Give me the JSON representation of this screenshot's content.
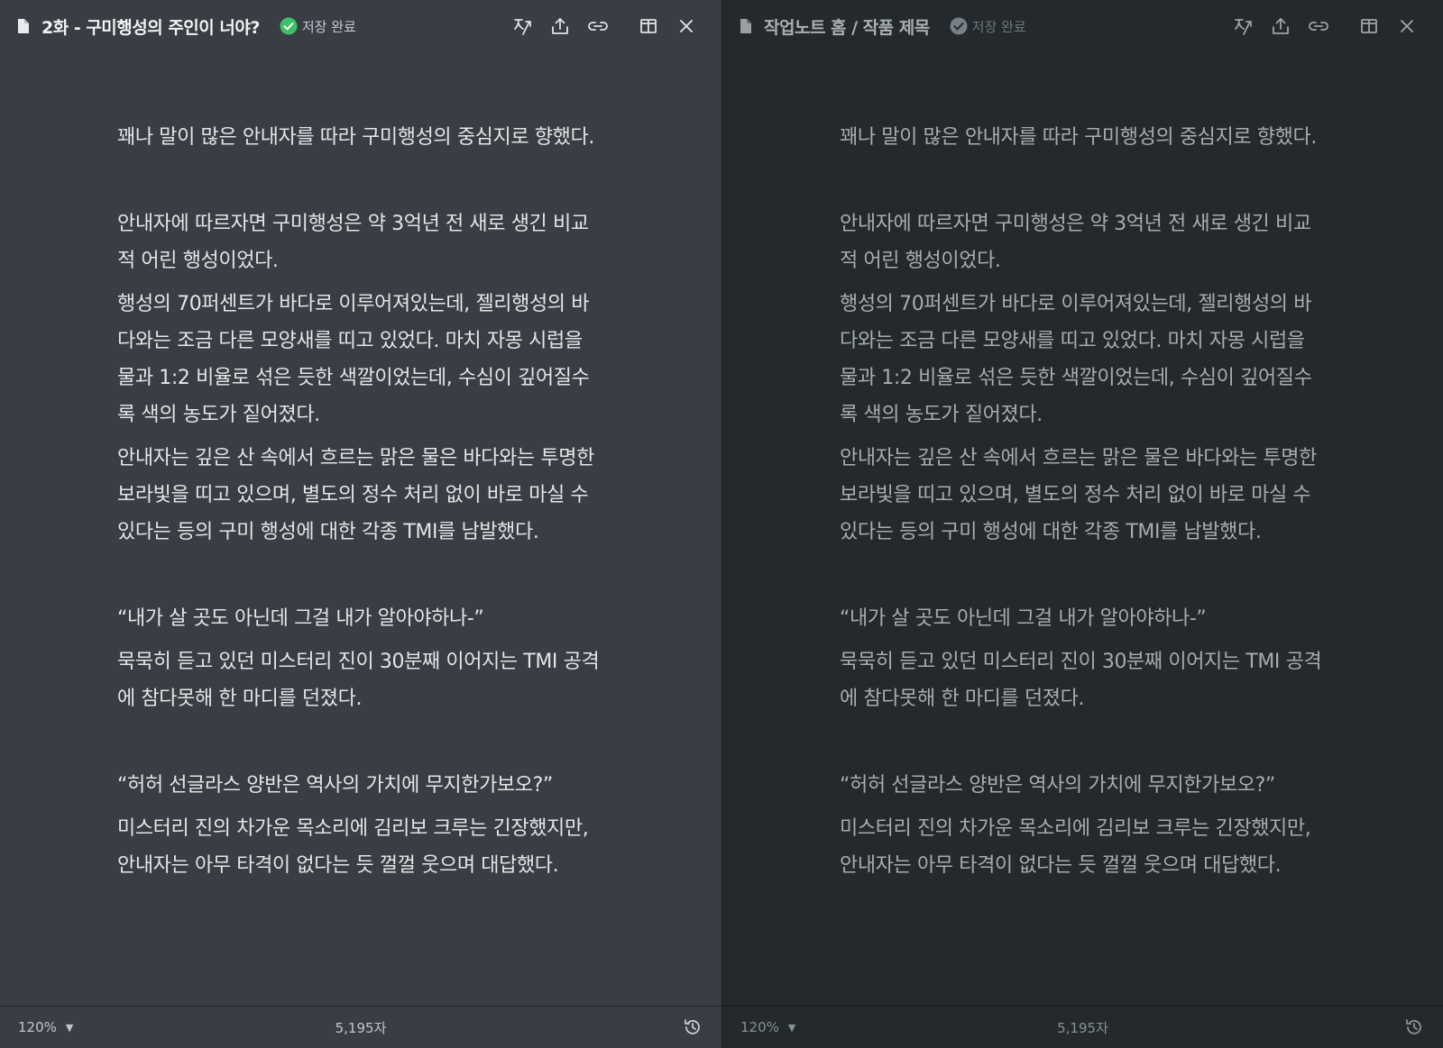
{
  "colors": {
    "left_bg": "#383e43",
    "right_bg": "#23292c",
    "saved_green": "#3fbf6a",
    "saved_gray": "#7a8186"
  },
  "panes": [
    {
      "title": "2화 - 구미행성의 주인이 너야?",
      "status": "저장 완료",
      "status_icon": "check-circle-icon",
      "paragraphs": [
        "꽤나 말이 많은 안내자를 따라 구미행성의 중심지로 향했다.",
        "안내자에 따르자면 구미행성은 약 3억년 전 새로 생긴 비교적 어린 행성이었다.",
        "행성의 70퍼센트가 바다로 이루어져있는데, 젤리행성의 바다와는 조금 다른 모양새를 띠고 있었다. 마치 자몽 시럽을 물과 1:2 비율로 섞은 듯한 색깔이었는데, 수심이 깊어질수록 색의 농도가 짙어졌다.",
        "안내자는 깊은 산 속에서 흐르는 맑은 물은 바다와는 투명한 보라빛을 띠고 있으며, 별도의 정수 처리 없이 바로 마실 수 있다는 등의 구미 행성에 대한 각종 TMI를 남발했다.",
        "“내가 살 곳도 아닌데 그걸 내가 알아야하나-”",
        "묵묵히 듣고 있던 미스터리 진이 30분째 이어지는 TMI 공격에 참다못해 한 마디를 던졌다.",
        "“허허 선글라스 양반은 역사의 가치에 무지한가보오?”",
        "미스터리 진의 차가운 목소리에 김리보 크루는 긴장했지만, 안내자는 아무 타격이 없다는 듯 껄껄 웃으며 대답했다."
      ],
      "zoom": "120%",
      "word_count": "5,195자"
    },
    {
      "title": "작업노트 홈 / 작품 제목",
      "status": "저장 완료",
      "status_icon": "check-circle-icon",
      "paragraphs": [
        "꽤나 말이 많은 안내자를 따라 구미행성의 중심지로 향했다.",
        "안내자에 따르자면 구미행성은 약 3억년 전 새로 생긴 비교적 어린 행성이었다.",
        "행성의 70퍼센트가 바다로 이루어져있는데, 젤리행성의 바다와는 조금 다른 모양새를 띠고 있었다. 마치 자몽 시럽을 물과 1:2 비율로 섞은 듯한 색깔이었는데, 수심이 깊어질수록 색의 농도가 짙어졌다.",
        "안내자는 깊은 산 속에서 흐르는 맑은 물은 바다와는 투명한 보라빛을 띠고 있으며, 별도의 정수 처리 없이 바로 마실 수 있다는 등의 구미 행성에 대한 각종 TMI를 남발했다.",
        "“내가 살 곳도 아닌데 그걸 내가 알아야하나-”",
        "묵묵히 듣고 있던 미스터리 진이 30분째 이어지는 TMI 공격에 참다못해 한 마디를 던졌다.",
        "“허허 선글라스 양반은 역사의 가치에 무지한가보오?”",
        "미스터리 진의 차가운 목소리에 김리보 크루는 긴장했지만, 안내자는 아무 타격이 없다는 듯 껄껄 웃으며 대답했다."
      ],
      "zoom": "120%",
      "word_count": "5,195자"
    }
  ]
}
